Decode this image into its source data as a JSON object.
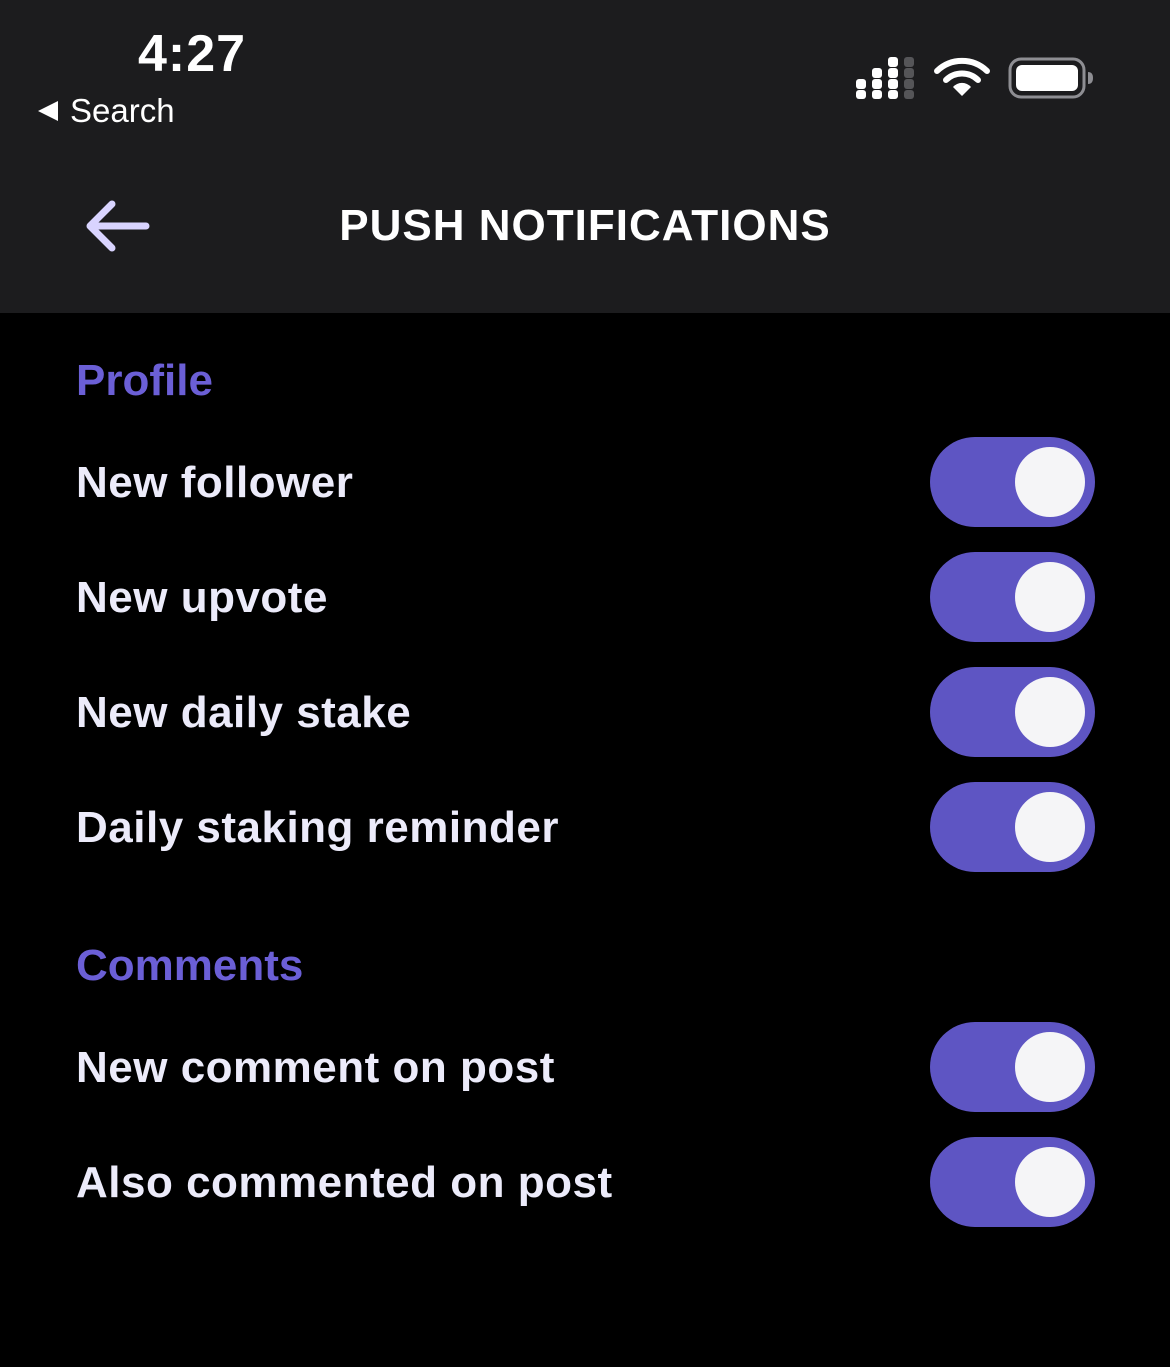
{
  "status_bar": {
    "time": "4:27",
    "back_to_app": "Search",
    "icons": [
      "cellular-signal-icon",
      "wifi-icon",
      "battery-icon"
    ]
  },
  "header": {
    "back_icon": "arrow-left-icon",
    "title": "PUSH NOTIFICATIONS"
  },
  "sections": [
    {
      "title": "Profile",
      "items": [
        {
          "label": "New follower",
          "enabled": true
        },
        {
          "label": "New upvote",
          "enabled": true
        },
        {
          "label": "New daily stake",
          "enabled": true
        },
        {
          "label": "Daily staking reminder",
          "enabled": true
        }
      ]
    },
    {
      "title": "Comments",
      "items": [
        {
          "label": "New comment on post",
          "enabled": true
        },
        {
          "label": "Also commented on post",
          "enabled": true
        }
      ]
    }
  ],
  "colors": {
    "background": "#000000",
    "topbar": "#1c1c1e",
    "accent": "#5e55c3",
    "section_title": "#6b5fd6",
    "toggle_knob": "#f5f5f7",
    "back_arrow": "#d9d4ff"
  }
}
